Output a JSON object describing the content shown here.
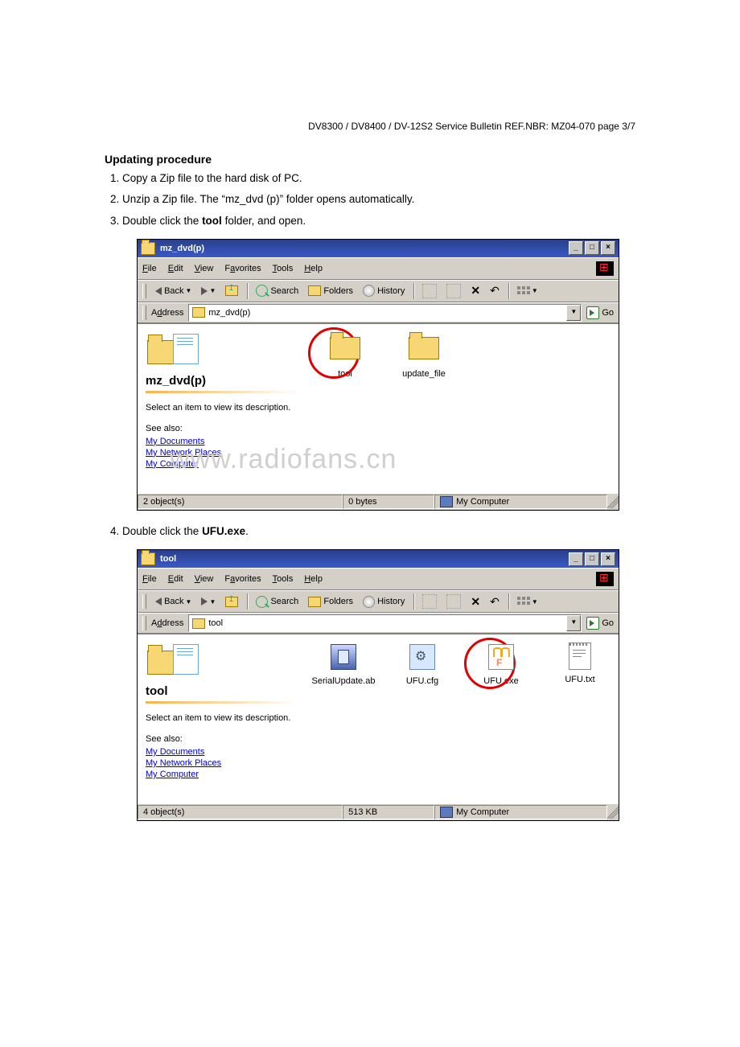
{
  "header": "DV8300 / DV8400 / DV-12S2 Service Bulletin REF.NBR: MZ04-070    page 3/7",
  "section_title": "Updating procedure",
  "steps": {
    "s1": "Copy a Zip file to the hard disk of PC.",
    "s2": "Unzip a Zip file. The “mz_dvd (p)” folder opens automatically.",
    "s3_pre": "Double click the ",
    "s3_bold": "tool",
    "s3_post": " folder, and open.",
    "s4_pre": "Double click the ",
    "s4_bold": "UFU.exe",
    "s4_post": "."
  },
  "menus": {
    "file": "File",
    "edit": "Edit",
    "view": "View",
    "favorites": "Favorites",
    "tools": "Tools",
    "help": "Help"
  },
  "toolbar": {
    "back": "Back",
    "search": "Search",
    "folders": "Folders",
    "history": "History"
  },
  "address_label": "Address",
  "go_label": "Go",
  "left_pane": {
    "hint": "Select an item to view its description.",
    "see": "See also:",
    "my_docs": "My Documents",
    "my_net": "My Network Places",
    "my_comp": "My Computer"
  },
  "watermark": "www.radiofans.cn",
  "win1": {
    "title": "mz_dvd(p)",
    "address": "mz_dvd(p)",
    "folder_title": "mz_dvd(p)",
    "items": {
      "tool": "tool",
      "update_file": "update_file"
    },
    "status": {
      "count": "2 object(s)",
      "size": "0 bytes",
      "loc": "My Computer"
    }
  },
  "win2": {
    "title": "tool",
    "address": "tool",
    "folder_title": "tool",
    "items": {
      "serial": "SerialUpdate.ab",
      "cfg": "UFU.cfg",
      "exe": "UFU.exe",
      "txt": "UFU.txt"
    },
    "status": {
      "count": "4 object(s)",
      "size": "513 KB",
      "loc": "My Computer"
    }
  }
}
